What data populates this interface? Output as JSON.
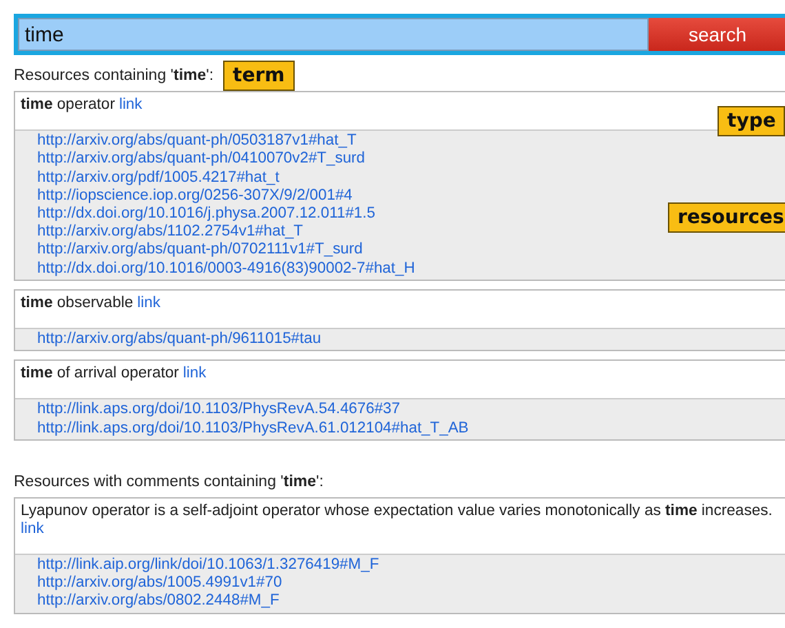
{
  "search": {
    "value": "time",
    "button": "search"
  },
  "annotations": [
    {
      "kind": "term",
      "label": "term"
    },
    {
      "kind": "type",
      "label": "type"
    },
    {
      "kind": "resources",
      "label": "resources"
    }
  ],
  "sections": [
    {
      "heading": "Resources containing '**time**':",
      "results": [
        {
          "title": "**time** operator",
          "link": "link",
          "resources": [
            "http://arxiv.org/abs/quant-ph/0503187v1#hat_T",
            "http://arxiv.org/abs/quant-ph/0410070v2#T_surd",
            "http://arxiv.org/pdf/1005.4217#hat_t",
            "http://iopscience.iop.org/0256-307X/9/2/001#4",
            "http://dx.doi.org/10.1016/j.physa.2007.12.011#1.5",
            "http://arxiv.org/abs/1102.2754v1#hat_T",
            "http://arxiv.org/abs/quant-ph/0702111v1#T_surd",
            "http://dx.doi.org/10.1016/0003-4916(83)90002-7#hat_H"
          ]
        },
        {
          "title": "**time** observable",
          "link": "link",
          "resources": [
            "http://arxiv.org/abs/quant-ph/9611015#tau"
          ]
        },
        {
          "title": "**time** of arrival operator",
          "link": "link",
          "resources": [
            "http://link.aps.org/doi/10.1103/PhysRevA.54.4676#37",
            "http://link.aps.org/doi/10.1103/PhysRevA.61.012104#hat_T_AB"
          ]
        }
      ]
    },
    {
      "heading": "Resources with comments containing '**time**':",
      "results": [
        {
          "title": "Lyapunov operator is a self-adjoint operator whose expectation value varies monotonically as **time** increases.",
          "link": "link",
          "resources": [
            "http://link.aip.org/link/doi/10.1063/1.3276419#M_F",
            "http://arxiv.org/abs/1005.4991v1#70",
            "http://arxiv.org/abs/0802.2448#M_F"
          ]
        }
      ]
    }
  ]
}
